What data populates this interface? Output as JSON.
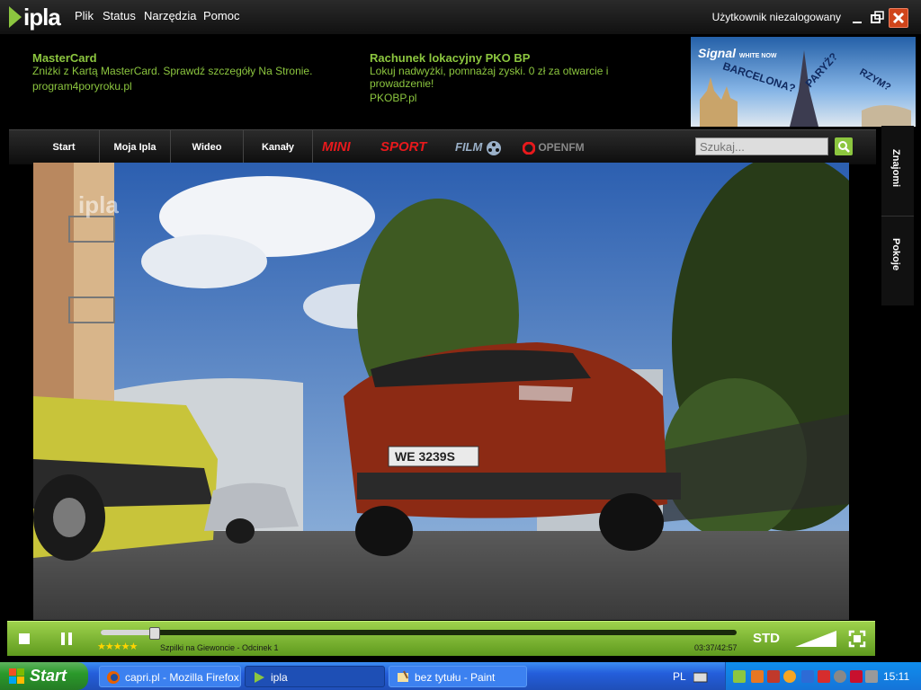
{
  "app": {
    "logo_text": "ipla",
    "menu": [
      "Plik",
      "Status",
      "Narzędzia",
      "Pomoc"
    ],
    "user_status": "Użytkownik niezalogowany",
    "window_buttons": [
      "minimize-icon",
      "restore-icon",
      "close-icon"
    ]
  },
  "ads": [
    {
      "title": "MasterCard",
      "text": "Zniżki z Kartą MasterCard. Sprawdź szczegóły Na Stronie.",
      "link": "program4poryroku.pl"
    },
    {
      "title": "Rachunek lokacyjny PKO BP",
      "text": "Lokuj nadwyżki, pomnażaj zyski. 0 zł za otwarcie i prowadzenie!",
      "link": "PKOBP.pl"
    }
  ],
  "banner": {
    "brand": "Signal",
    "brand_small": "WHITE NOW",
    "words": [
      "BARCELONA?",
      "PARYŻ?",
      "RZYM?"
    ]
  },
  "nav": {
    "items": [
      "Start",
      "Moja Ipla",
      "Wideo",
      "Kanały"
    ],
    "channels": [
      "MINI",
      "SPORT",
      "FILM",
      "OPENFM"
    ],
    "search_placeholder": "Szukaj..."
  },
  "sidebar": {
    "tabs": [
      "Znajomi",
      "Pokoje"
    ]
  },
  "video": {
    "watermark": "ipla",
    "plate": "WE 3239S"
  },
  "player": {
    "rating_stars": 5,
    "stars": "★★★★★",
    "title": "Szpilki na Giewoncie - Odcinek 1",
    "time": "03:37/42:57",
    "progress_fraction": 0.084,
    "quality": "STD",
    "volume_fraction": 1.0
  },
  "taskbar": {
    "start_label": "Start",
    "tasks": [
      {
        "label": "capri.pl - Mozilla Firefox",
        "active": false
      },
      {
        "label": "ipla",
        "active": true
      },
      {
        "label": "bez tytułu - Paint",
        "active": false
      }
    ],
    "language": "PL",
    "clock": "15:11"
  },
  "colors": {
    "accent": "#8cc63f",
    "control_bar": "#7cbf2e",
    "close_red": "#d0451b",
    "sport_red": "#e8191c",
    "mini_red": "#e8191c"
  }
}
